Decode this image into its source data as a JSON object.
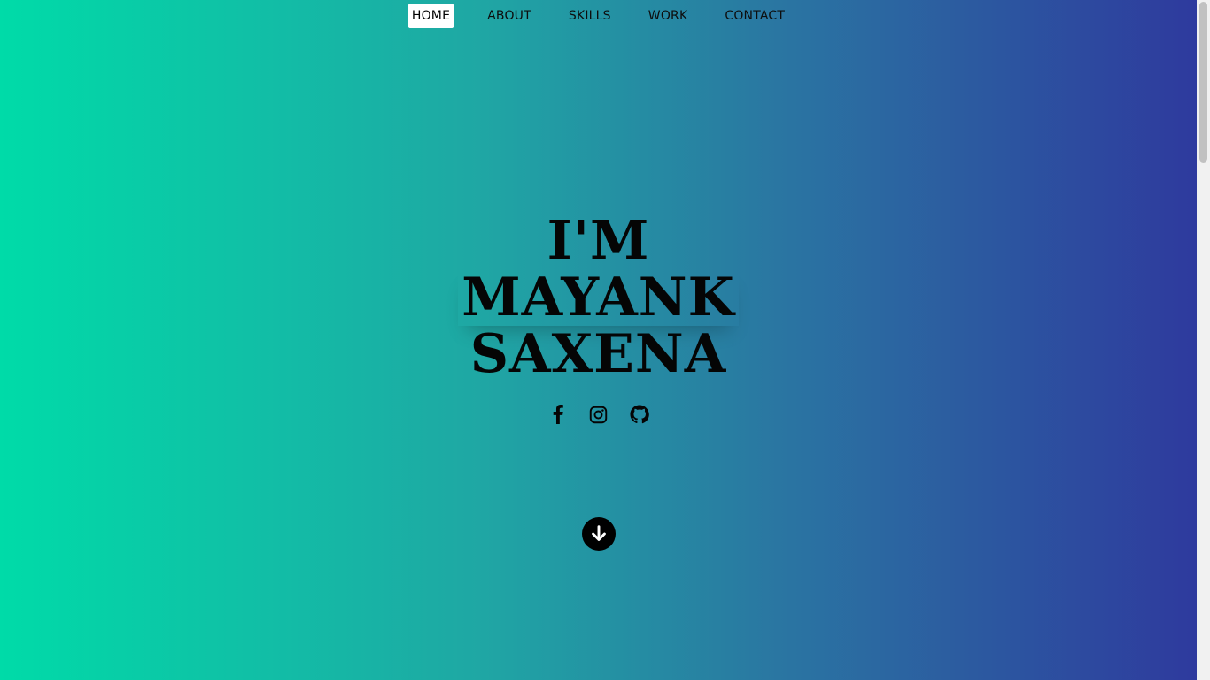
{
  "nav": {
    "items": [
      {
        "label": "HOME",
        "active": true
      },
      {
        "label": "ABOUT",
        "active": false
      },
      {
        "label": "SKILLS",
        "active": false
      },
      {
        "label": "WORK",
        "active": false
      },
      {
        "label": "CONTACT",
        "active": false
      }
    ]
  },
  "hero": {
    "line1": "I'M",
    "line2": "MAYANK",
    "line3": "SAXENA"
  },
  "socials": {
    "icons": [
      "facebook-icon",
      "instagram-icon",
      "github-icon"
    ]
  },
  "scroll_down": {
    "icon": "arrow-down-circle-icon"
  },
  "colors": {
    "gradient_start": "#00dba8",
    "gradient_end": "#2e3a9e",
    "text": "#050505",
    "nav_active_bg": "#ffffff"
  }
}
